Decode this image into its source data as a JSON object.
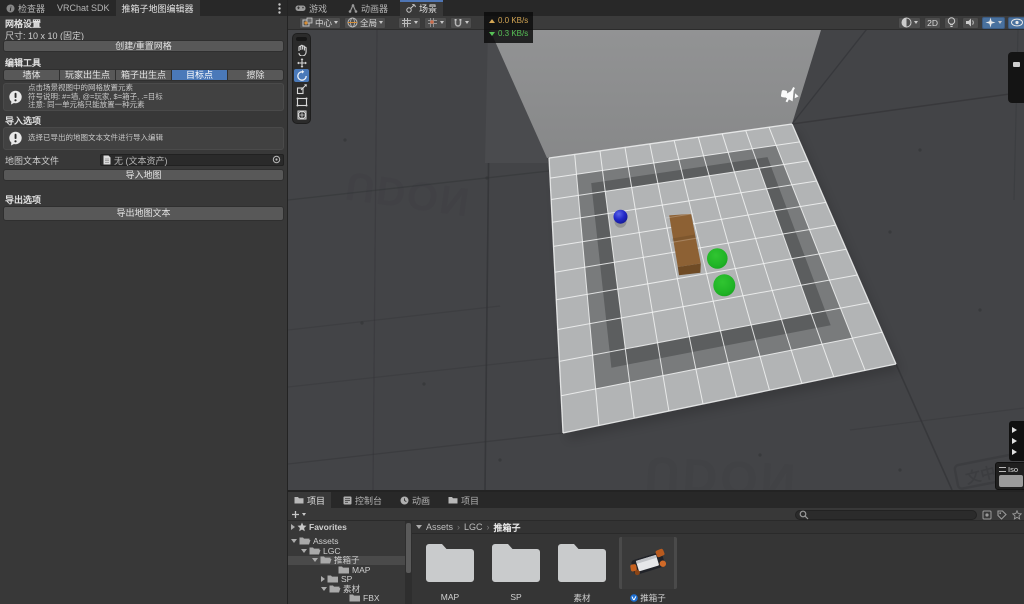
{
  "colors": {
    "selection_blue": "#4a79b9",
    "toggle_blue": "#49719e",
    "focus_tab_line": "#4f76b5",
    "upload_text": "#d2a554",
    "download_text": "#56c156"
  },
  "inspector": {
    "tabs": [
      {
        "label": "检查器"
      },
      {
        "label": "VRChat SDK"
      },
      {
        "label": "推箱子地图编辑器",
        "active": true
      }
    ],
    "grid_settings_header": "网格设置",
    "size_label": "尺寸: 10 x 10 (固定)",
    "create_reset_button": "创建/重置网格",
    "edit_tools_header": "编辑工具",
    "tool_buttons": [
      {
        "label": "墙体"
      },
      {
        "label": "玩家出生点"
      },
      {
        "label": "箱子出生点"
      },
      {
        "label": "目标点",
        "selected": true
      },
      {
        "label": "擦除"
      }
    ],
    "help_line1": "点击场景视图中的网格放置元素",
    "help_line2": "符号说明: #=墙, @=玩家, $=箱子, .=目标",
    "help_line3": "注意: 同一单元格只能放置一种元素",
    "import_header": "导入选项",
    "import_help": "选择已导出的地图文本文件进行导入编辑",
    "map_file_label": "地图文本文件",
    "map_file_value": "无 (文本资产)",
    "import_button": "导入地图",
    "export_header": "导出选项",
    "export_button": "导出地图文本"
  },
  "scene": {
    "tabs": [
      {
        "label": "游戏"
      },
      {
        "label": "动画器"
      },
      {
        "label": "场景",
        "active": true
      }
    ],
    "toolbar": {
      "handle_position": "中心",
      "rotation": "全局",
      "mode_2d": "2D"
    },
    "network": {
      "upload": "0.0 KB/s",
      "download": "0.3 KB/s"
    },
    "orientation_label": "Iso",
    "map": {
      "grid_size": "10 x 10",
      "wall_ring": "1-cell ring inset 1 cell from border",
      "objects": [
        {
          "type": "player-spawn-sphere",
          "color": "#2c33d2",
          "cell": [
            2,
            3
          ]
        },
        {
          "type": "box-spawn",
          "color": "#8d6134",
          "cells": [
            [
              4,
              4
            ],
            [
              4,
              5
            ]
          ]
        },
        {
          "type": "goal-marker",
          "color": "#22b826",
          "cell": [
            5,
            5
          ]
        },
        {
          "type": "goal-marker",
          "color": "#22b826",
          "cell": [
            5,
            6
          ]
        }
      ]
    }
  },
  "project": {
    "tabs": [
      {
        "label": "项目",
        "active": true
      },
      {
        "label": "控制台"
      },
      {
        "label": "动画"
      },
      {
        "label": "项目"
      }
    ],
    "favorites_label": "Favorites",
    "tree": [
      {
        "label": "Assets"
      },
      {
        "label": "LGC"
      },
      {
        "label": "推箱子",
        "selected": true
      },
      {
        "label": "MAP"
      },
      {
        "label": "SP"
      },
      {
        "label": "素材"
      },
      {
        "label": "FBX"
      }
    ],
    "breadcrumb": {
      "part1": "Assets",
      "part2": "LGC",
      "part3": "推箱子",
      "separator": "›"
    },
    "items": [
      {
        "label": "MAP",
        "type": "folder"
      },
      {
        "label": "SP",
        "type": "folder"
      },
      {
        "label": "素材",
        "type": "folder"
      },
      {
        "label": "推箱子",
        "type": "prefab",
        "selected": true
      }
    ]
  }
}
